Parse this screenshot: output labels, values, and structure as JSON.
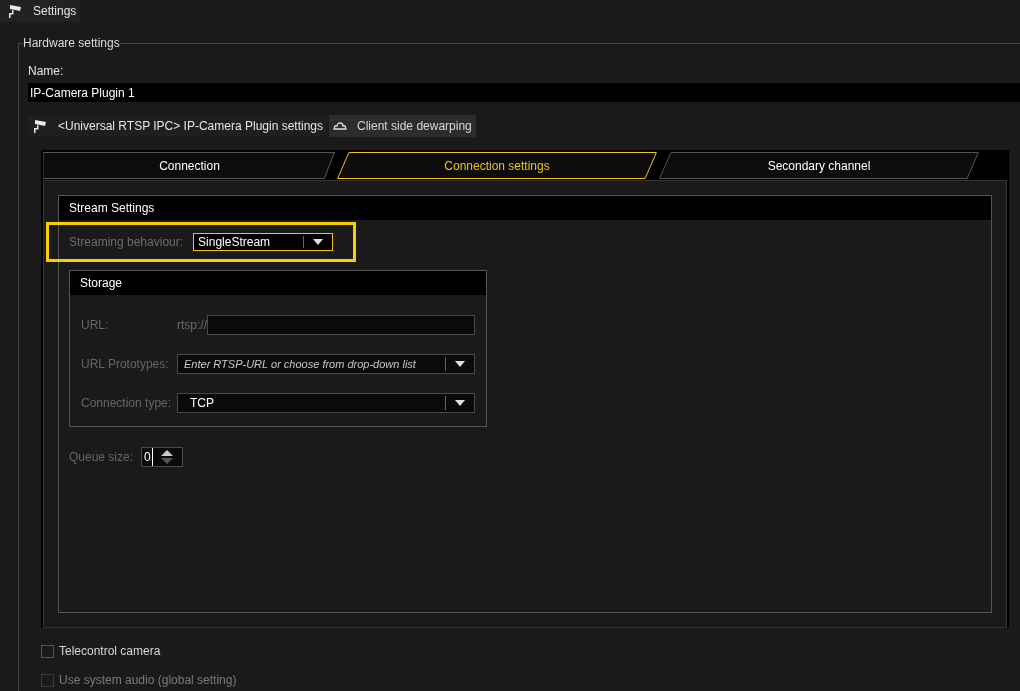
{
  "window": {
    "title": "Settings"
  },
  "hardware_settings": {
    "legend": "Hardware settings",
    "name_label": "Name:",
    "name_value": "IP-Camera Plugin 1",
    "plugin_tabs": [
      {
        "label": "<Universal RTSP IPC> IP-Camera Plugin settings",
        "selected": true
      },
      {
        "label": "Client side dewarping",
        "selected": false
      }
    ]
  },
  "tabs": [
    {
      "label": "Connection",
      "selected": false
    },
    {
      "label": "Connection settings",
      "selected": true
    },
    {
      "label": "Secondary channel",
      "selected": false
    }
  ],
  "stream_settings": {
    "title": "Stream Settings",
    "streaming_behaviour": {
      "label": "Streaming behaviour:",
      "value": "SingleStream",
      "highlighted": true
    },
    "storage": {
      "title": "Storage",
      "url_label": "URL:",
      "url_prefix": "rtsp://",
      "prototypes_label": "URL Prototypes:",
      "prototypes_placeholder": "Enter RTSP-URL or choose from drop-down list",
      "connection_type_label": "Connection type:",
      "connection_type_value": "TCP"
    },
    "queue_size": {
      "label": "Queue size:",
      "value": "0"
    }
  },
  "checkboxes": [
    {
      "label": "Telecontrol camera",
      "checked": false,
      "disabled": false
    },
    {
      "label": "Use system audio (global setting)",
      "checked": false,
      "disabled": true
    }
  ]
}
